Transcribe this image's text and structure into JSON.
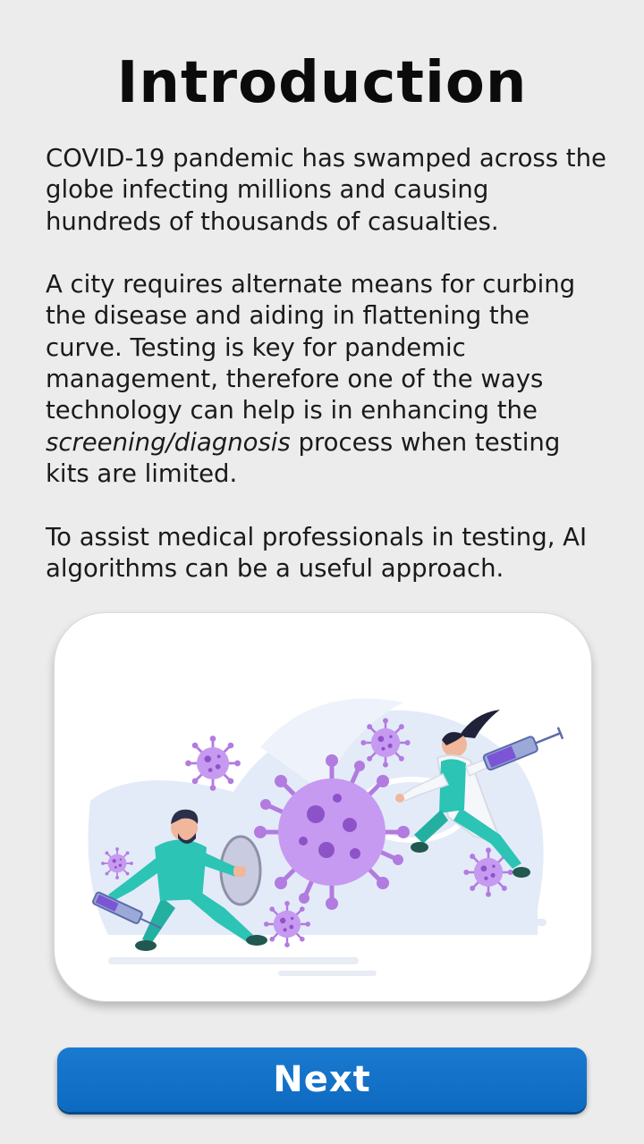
{
  "screen": {
    "title": "Introduction"
  },
  "intro": {
    "paragraph1": "COVID-19 pandemic has swamped across the globe infecting millions and causing hundreds of thousands of casualties.",
    "paragraph2_lead": "A city requires alternate means for curbing the disease and aiding in flattening the curve. Testing is key for pandemic management, therefore one of the ways technology can help is in enhancing the ",
    "paragraph2_emphasis": "screening/diagnosis",
    "paragraph2_tail": " process when testing kits are limited.",
    "paragraph3": "To assist medical professionals in testing, AI algorithms can be a useful approach."
  },
  "illustration": {
    "icon": "doctors-fighting-virus-illustration",
    "colors": {
      "virus": "#b27be0",
      "virus_dark": "#8e52c8",
      "scrubs": "#2cc4b4",
      "background_blob": "#e3ebf8"
    }
  },
  "footer": {
    "next_label": "Next",
    "button_color": "#1272c8"
  }
}
